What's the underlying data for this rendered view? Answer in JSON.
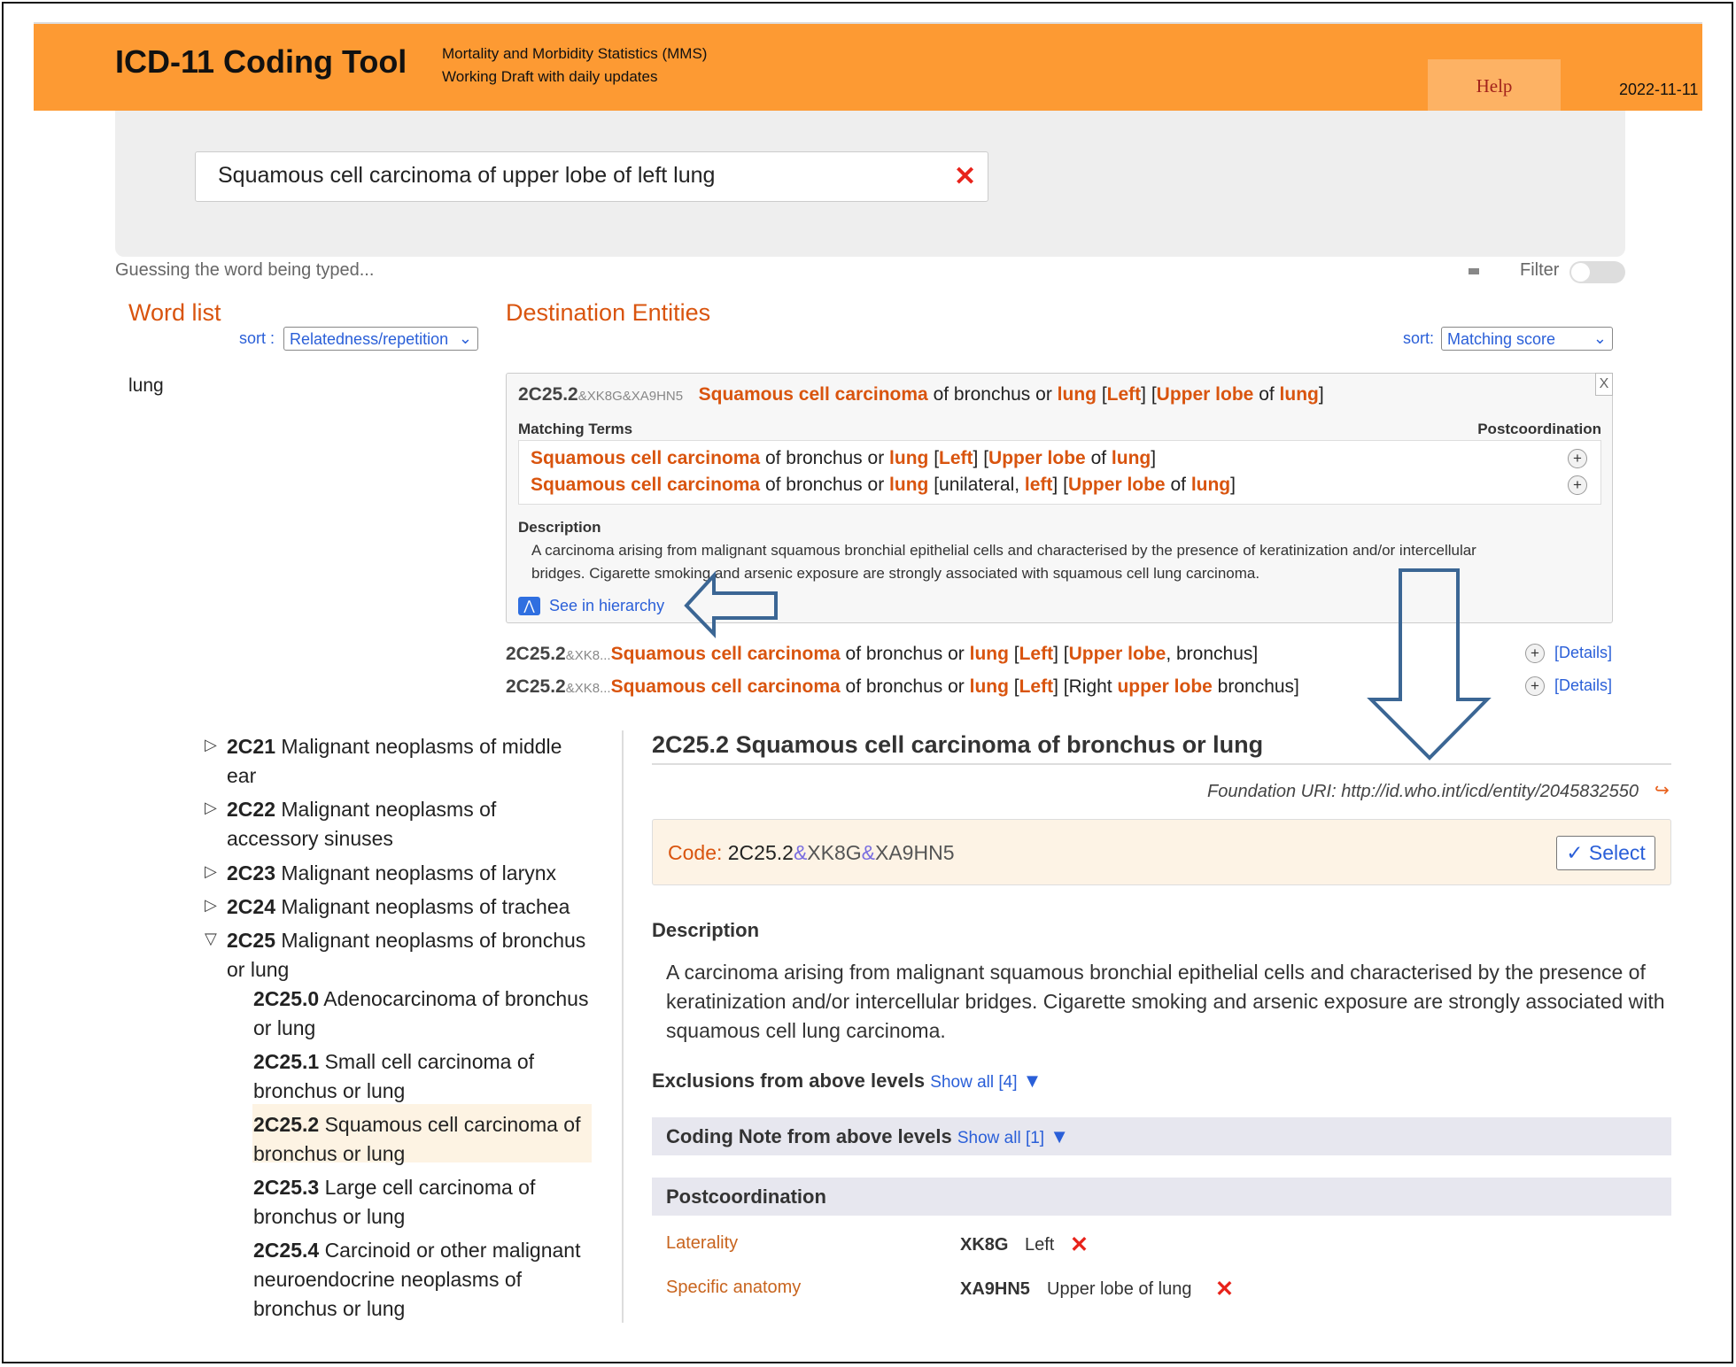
{
  "header": {
    "title": "ICD-11 Coding Tool",
    "subtitle1": "Mortality and Morbidity Statistics (MMS)",
    "subtitle2": "Working Draft with daily updates",
    "help": "Help",
    "date": "2022-11-11"
  },
  "search": {
    "value": "Squamous cell carcinoma of upper lobe of left lung",
    "status": "Guessing the word being typed...",
    "filter_label": "Filter",
    "filter_on": false
  },
  "word_list": {
    "title": "Word list",
    "sort_label": "sort :",
    "sort_value": "Relatedness/repetition",
    "items": [
      "lung"
    ]
  },
  "destination": {
    "title": "Destination Entities",
    "sort_label": "sort:",
    "sort_value": "Matching score",
    "top": {
      "code": "2C25.2",
      "code_ext": "&XK8G&XA9HN5",
      "title": [
        {
          "text": "Squamous cell carcinoma",
          "hl": true
        },
        {
          "text": " of bronchus or ",
          "hl": false
        },
        {
          "text": "lung",
          "hl": true
        },
        {
          "text": " [",
          "hl": false
        },
        {
          "text": "Left",
          "hl": true
        },
        {
          "text": "] [",
          "hl": false
        },
        {
          "text": "Upper lobe",
          "hl": true
        },
        {
          "text": " of ",
          "hl": false
        },
        {
          "text": "lung",
          "hl": true
        },
        {
          "text": "]",
          "hl": false
        }
      ],
      "matching_terms_label": "Matching Terms",
      "postcoordination_label": "Postcoordination",
      "terms": [
        [
          {
            "text": "Squamous cell carcinoma",
            "hl": true
          },
          {
            "text": " of bronchus or ",
            "hl": false
          },
          {
            "text": "lung",
            "hl": true
          },
          {
            "text": " [",
            "hl": false
          },
          {
            "text": "Left",
            "hl": true
          },
          {
            "text": "] [",
            "hl": false
          },
          {
            "text": "Upper lobe",
            "hl": true
          },
          {
            "text": " of ",
            "hl": false
          },
          {
            "text": "lung",
            "hl": true
          },
          {
            "text": "]",
            "hl": false
          }
        ],
        [
          {
            "text": "Squamous cell carcinoma",
            "hl": true
          },
          {
            "text": " of bronchus or ",
            "hl": false
          },
          {
            "text": "lung",
            "hl": true
          },
          {
            "text": " [unilateral, ",
            "hl": false
          },
          {
            "text": "left",
            "hl": true
          },
          {
            "text": "] [",
            "hl": false
          },
          {
            "text": "Upper lobe",
            "hl": true
          },
          {
            "text": " of ",
            "hl": false
          },
          {
            "text": "lung",
            "hl": true
          },
          {
            "text": "]",
            "hl": false
          }
        ]
      ],
      "description_label": "Description",
      "description1": "A carcinoma arising from malignant squamous bronchial epithelial cells and characterised by the presence of keratinization and/or intercellular",
      "description2": "bridges. Cigarette smoking and arsenic exposure are strongly associated with squamous cell lung carcinoma.",
      "hierarchy_link": "See in hierarchy",
      "close": "X"
    },
    "others": [
      {
        "code": "2C25.2",
        "code_ext": "&XK8...",
        "title": [
          {
            "text": "Squamous cell carcinoma",
            "hl": true
          },
          {
            "text": " of bronchus or ",
            "hl": false
          },
          {
            "text": "lung",
            "hl": true
          },
          {
            "text": " [",
            "hl": false
          },
          {
            "text": "Left",
            "hl": true
          },
          {
            "text": "] [",
            "hl": false
          },
          {
            "text": "Upper lobe",
            "hl": true
          },
          {
            "text": ", bronchus]",
            "hl": false
          }
        ],
        "details": "[Details]"
      },
      {
        "code": "2C25.2",
        "code_ext": "&XK8...",
        "title": [
          {
            "text": "Squamous cell carcinoma",
            "hl": true
          },
          {
            "text": " of bronchus or ",
            "hl": false
          },
          {
            "text": "lung",
            "hl": true
          },
          {
            "text": " [",
            "hl": false
          },
          {
            "text": "Left",
            "hl": true
          },
          {
            "text": "] [Right ",
            "hl": false
          },
          {
            "text": "upper lobe",
            "hl": true
          },
          {
            "text": " bronchus]",
            "hl": false
          }
        ],
        "details": "[Details]"
      }
    ]
  },
  "tree": [
    {
      "code": "2C21",
      "label": "Malignant neoplasms of middle ear",
      "expanded": false
    },
    {
      "code": "2C22",
      "label": "Malignant neoplasms of accessory sinuses",
      "expanded": false
    },
    {
      "code": "2C23",
      "label": "Malignant neoplasms of larynx",
      "expanded": false
    },
    {
      "code": "2C24",
      "label": "Malignant neoplasms of trachea",
      "expanded": false
    },
    {
      "code": "2C25",
      "label": "Malignant neoplasms of bronchus or lung",
      "expanded": true
    },
    {
      "code": "2C25.0",
      "label": "Adenocarcinoma of bronchus or lung"
    },
    {
      "code": "2C25.1",
      "label": "Small cell carcinoma of bronchus or lung"
    },
    {
      "code": "2C25.2",
      "label": "Squamous cell carcinoma of bronchus or lung",
      "selected": true
    },
    {
      "code": "2C25.3",
      "label": "Large cell carcinoma of bronchus or lung"
    },
    {
      "code": "2C25.4",
      "label": "Carcinoid or other malignant neuroendocrine neoplasms of bronchus or lung"
    }
  ],
  "detail": {
    "title": "2C25.2 Squamous cell carcinoma of bronchus or lung",
    "foundation_uri": "Foundation URI: http://id.who.int/icd/entity/2045832550",
    "code_label": "Code:",
    "code": "2C25.2",
    "amp": "&",
    "ext1": "XK8G",
    "ext2": "XA9HN5",
    "select": "✓ Select",
    "description_label": "Description",
    "description": "A carcinoma arising from malignant squamous bronchial epithelial cells and characterised by the presence of keratinization and/or intercellular bridges. Cigarette smoking and arsenic exposure are strongly associated with squamous cell lung carcinoma.",
    "exclusions_label": "Exclusions from above levels",
    "exclusions_link": "Show all [4]",
    "coding_note_label": "Coding Note from above levels",
    "coding_note_link": "Show all [1]",
    "postcoordination_label": "Postcoordination",
    "post": [
      {
        "axis": "Laterality",
        "code": "XK8G",
        "value": "Left"
      },
      {
        "axis": "Specific anatomy",
        "code": "XA9HN5",
        "value": "Upper lobe of lung"
      }
    ]
  },
  "colors": {
    "header": "#fd9a33",
    "highlight": "#d9540e",
    "link": "#2a5fd8",
    "arrow": "#3b6694"
  }
}
